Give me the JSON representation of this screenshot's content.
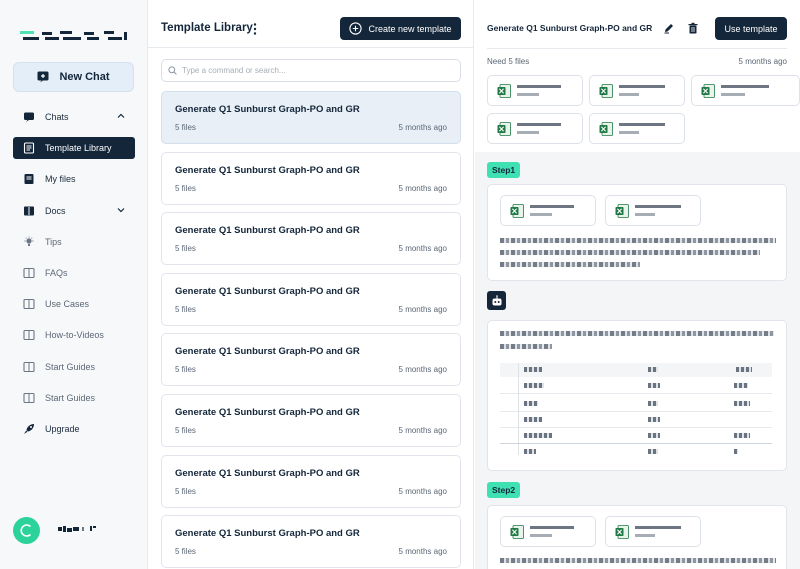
{
  "sidebar": {
    "new_chat_label": "New Chat",
    "items": [
      {
        "label": "Chats",
        "icon": "chat-icon",
        "chevron": "up"
      },
      {
        "label": "Template Library",
        "icon": "document-icon",
        "active": true
      },
      {
        "label": "My files",
        "icon": "folder-icon"
      },
      {
        "label": "Docs",
        "icon": "book-icon",
        "chevron": "down"
      },
      {
        "label": "Tips",
        "icon": "lightbulb-icon"
      },
      {
        "label": "FAQs",
        "icon": "book-icon"
      },
      {
        "label": "Use Cases",
        "icon": "book-icon"
      },
      {
        "label": "How-to-Videos",
        "icon": "book-icon"
      },
      {
        "label": "Start Guides",
        "icon": "book-icon"
      },
      {
        "label": "Start Guides",
        "icon": "book-icon"
      },
      {
        "label": "Upgrade",
        "icon": "rocket-icon"
      }
    ],
    "avatar_color": "#2bd39a"
  },
  "library": {
    "title": "Template Library",
    "create_label": "Create new template",
    "search_placeholder": "Type a command or search...",
    "cards": [
      {
        "title": "Generate Q1 Sunburst Graph-PO and GR",
        "files": "5 files",
        "time": "5 months ago",
        "selected": true
      },
      {
        "title": "Generate Q1 Sunburst Graph-PO and GR",
        "files": "5 files",
        "time": "5 months ago"
      },
      {
        "title": "Generate Q1 Sunburst Graph-PO and GR",
        "files": "5 files",
        "time": "5 months ago"
      },
      {
        "title": "Generate Q1 Sunburst Graph-PO and GR",
        "files": "5 files",
        "time": "5 months ago"
      },
      {
        "title": "Generate Q1 Sunburst Graph-PO and GR",
        "files": "5 files",
        "time": "5 months ago"
      },
      {
        "title": "Generate Q1 Sunburst Graph-PO and GR",
        "files": "5 files",
        "time": "5 months ago"
      },
      {
        "title": "Generate Q1 Sunburst Graph-PO and GR",
        "files": "5 files",
        "time": "5 months ago"
      },
      {
        "title": "Generate Q1 Sunburst Graph-PO and GR",
        "files": "5 files",
        "time": "5 months ago"
      }
    ]
  },
  "detail": {
    "title": "Generate Q1 Sunburst Graph-PO and GR",
    "use_label": "Use template",
    "need_label": "Need 5 files",
    "need_time": "5 months ago",
    "step1": "Step1",
    "step2": "Step2",
    "accent": "#3fe0b1",
    "primary": "#13263a"
  }
}
